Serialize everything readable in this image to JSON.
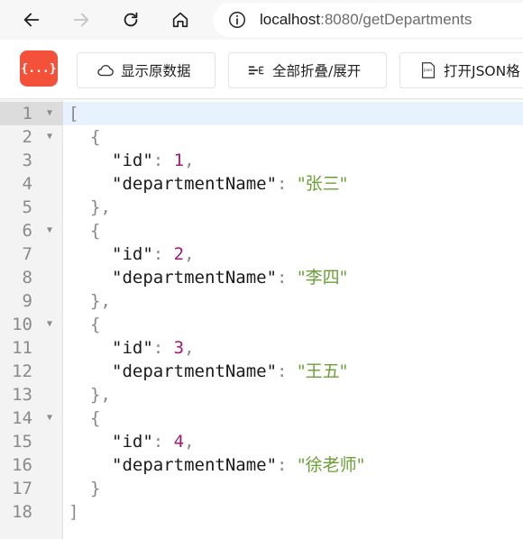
{
  "browser": {
    "url_host": "localhost",
    "url_rest": ":8080/getDepartments"
  },
  "toolbar": {
    "logo_text": "{...}",
    "show_raw_label": "显示原数据",
    "fold_all_label": "全部折叠/展开",
    "open_json_label": "打开JSON格"
  },
  "json_lines": [
    {
      "n": "1",
      "indent": 0,
      "foldable": true,
      "parts": [
        [
          "punct",
          "["
        ]
      ]
    },
    {
      "n": "2",
      "indent": 1,
      "foldable": true,
      "parts": [
        [
          "punct",
          "{"
        ]
      ]
    },
    {
      "n": "3",
      "indent": 2,
      "foldable": false,
      "parts": [
        [
          "key",
          "\"id\""
        ],
        [
          "punct",
          ": "
        ],
        [
          "num",
          "1"
        ],
        [
          "punct",
          ","
        ]
      ]
    },
    {
      "n": "4",
      "indent": 2,
      "foldable": false,
      "parts": [
        [
          "key",
          "\"departmentName\""
        ],
        [
          "punct",
          ": "
        ],
        [
          "str",
          "\"张三\""
        ]
      ]
    },
    {
      "n": "5",
      "indent": 1,
      "foldable": false,
      "parts": [
        [
          "punct",
          "},"
        ]
      ]
    },
    {
      "n": "6",
      "indent": 1,
      "foldable": true,
      "parts": [
        [
          "punct",
          "{"
        ]
      ]
    },
    {
      "n": "7",
      "indent": 2,
      "foldable": false,
      "parts": [
        [
          "key",
          "\"id\""
        ],
        [
          "punct",
          ": "
        ],
        [
          "num",
          "2"
        ],
        [
          "punct",
          ","
        ]
      ]
    },
    {
      "n": "8",
      "indent": 2,
      "foldable": false,
      "parts": [
        [
          "key",
          "\"departmentName\""
        ],
        [
          "punct",
          ": "
        ],
        [
          "str",
          "\"李四\""
        ]
      ]
    },
    {
      "n": "9",
      "indent": 1,
      "foldable": false,
      "parts": [
        [
          "punct",
          "},"
        ]
      ]
    },
    {
      "n": "10",
      "indent": 1,
      "foldable": true,
      "parts": [
        [
          "punct",
          "{"
        ]
      ]
    },
    {
      "n": "11",
      "indent": 2,
      "foldable": false,
      "parts": [
        [
          "key",
          "\"id\""
        ],
        [
          "punct",
          ": "
        ],
        [
          "num",
          "3"
        ],
        [
          "punct",
          ","
        ]
      ]
    },
    {
      "n": "12",
      "indent": 2,
      "foldable": false,
      "parts": [
        [
          "key",
          "\"departmentName\""
        ],
        [
          "punct",
          ": "
        ],
        [
          "str",
          "\"王五\""
        ]
      ]
    },
    {
      "n": "13",
      "indent": 1,
      "foldable": false,
      "parts": [
        [
          "punct",
          "},"
        ]
      ]
    },
    {
      "n": "14",
      "indent": 1,
      "foldable": true,
      "parts": [
        [
          "punct",
          "{"
        ]
      ]
    },
    {
      "n": "15",
      "indent": 2,
      "foldable": false,
      "parts": [
        [
          "key",
          "\"id\""
        ],
        [
          "punct",
          ": "
        ],
        [
          "num",
          "4"
        ],
        [
          "punct",
          ","
        ]
      ]
    },
    {
      "n": "16",
      "indent": 2,
      "foldable": false,
      "parts": [
        [
          "key",
          "\"departmentName\""
        ],
        [
          "punct",
          ": "
        ],
        [
          "str",
          "\"徐老师\""
        ]
      ]
    },
    {
      "n": "17",
      "indent": 1,
      "foldable": false,
      "parts": [
        [
          "punct",
          "}"
        ]
      ]
    },
    {
      "n": "18",
      "indent": 0,
      "foldable": false,
      "parts": [
        [
          "punct",
          "]"
        ]
      ]
    }
  ],
  "colors": {
    "string": "#6aa037",
    "number": "#9c1a78",
    "logo_bg": "#f4513a",
    "active_line": "#e8f2ff"
  },
  "icons": {
    "back": "arrow-left-icon",
    "forward": "arrow-right-icon",
    "reload": "reload-icon",
    "home": "home-icon",
    "site_info": "info-icon",
    "show_raw": "cloud-icon",
    "fold_all": "fold-icon",
    "open_json": "json-file-icon"
  }
}
